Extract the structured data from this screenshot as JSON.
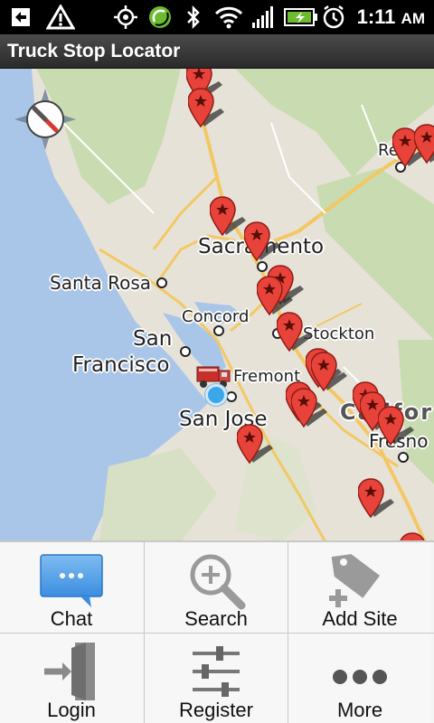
{
  "status_bar": {
    "time": "1:11",
    "ampm": "AM",
    "icons": [
      "usb-debug-icon",
      "warning-icon",
      "gps-icon",
      "sync-icon",
      "bluetooth-icon",
      "wifi-icon",
      "signal-icon",
      "battery-charging-icon",
      "alarm-icon"
    ]
  },
  "app": {
    "title": "Truck Stop Locator"
  },
  "map": {
    "places": {
      "sacramento": "Sacramento",
      "santa_rosa": "Santa Rosa",
      "concord": "Concord",
      "san": "San",
      "francisco": "Francisco",
      "fremont": "Fremont",
      "san_jose": "San Jose",
      "stockton": "Stockton",
      "reno": "Re",
      "fresno": "Fresno",
      "california": "Califor"
    },
    "colors": {
      "land": "#e6e2d8",
      "forest": "#c9dbb0",
      "water": "#a9c6e8",
      "highway": "#f3c864",
      "pin": "#e8433a"
    }
  },
  "menu": {
    "items": [
      {
        "label": "Chat",
        "icon": "chat-bubble-icon"
      },
      {
        "label": "Search",
        "icon": "magnifier-plus-icon"
      },
      {
        "label": "Add Site",
        "icon": "tag-plus-icon"
      },
      {
        "label": "Login",
        "icon": "login-door-icon"
      },
      {
        "label": "Register",
        "icon": "sliders-icon"
      },
      {
        "label": "More",
        "icon": "more-dots-icon"
      }
    ]
  }
}
